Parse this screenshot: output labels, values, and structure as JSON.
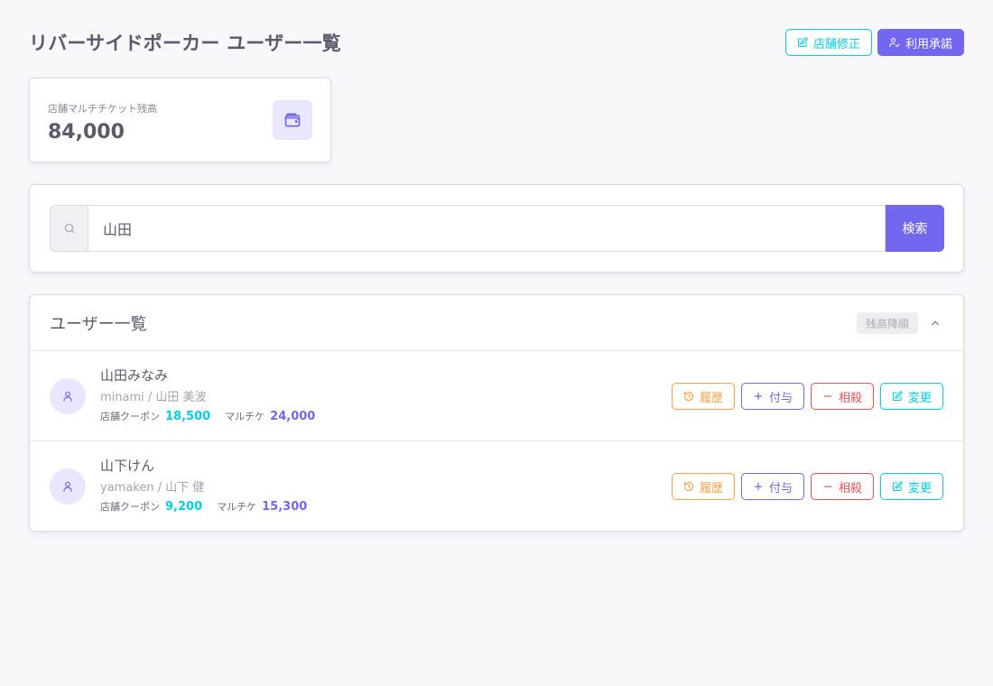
{
  "page": {
    "title": "リバーサイドポーカー ユーザー一覧"
  },
  "header_actions": {
    "edit_store_label": "店舗修正",
    "approve_label": "利用承諾"
  },
  "stat": {
    "label": "店舗マルチチケット残高",
    "value": "84,000",
    "icon": "wallet-icon"
  },
  "search": {
    "value": "山田",
    "placeholder": "",
    "button_label": "検索"
  },
  "user_list": {
    "title": "ユーザー一覧",
    "sort_badge": "残高降順",
    "users": [
      {
        "name": "山田みなみ",
        "sub": "minami / 山田 美波",
        "coupon_label": "店舗クーポン",
        "coupon_value": "18,500",
        "multi_label": "マルチケ",
        "multi_value": "24,000"
      },
      {
        "name": "山下けん",
        "sub": "yamaken / 山下 健",
        "coupon_label": "店舗クーポン",
        "coupon_value": "9,200",
        "multi_label": "マルチケ",
        "multi_value": "15,300"
      }
    ],
    "actions": {
      "history_label": "履歴",
      "grant_label": "付与",
      "offset_label": "相殺",
      "change_label": "変更"
    }
  },
  "colors": {
    "primary": "#7367f0",
    "cyan": "#00cfe8",
    "orange": "#ff9f43",
    "red": "#ea5455",
    "background": "#f8f7fa"
  }
}
